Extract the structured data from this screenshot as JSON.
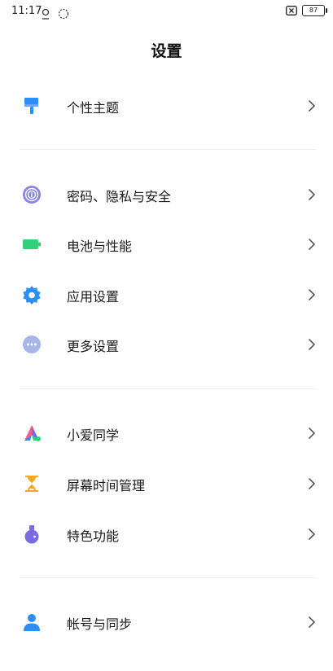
{
  "status_bar": {
    "time": "11:17",
    "battery": "87"
  },
  "header": {
    "title": "设置"
  },
  "groups": [
    {
      "items": [
        {
          "label": "个性主题",
          "icon": "paintbrush-icon"
        }
      ]
    },
    {
      "items": [
        {
          "label": "密码、隐私与安全",
          "icon": "fingerprint-icon"
        },
        {
          "label": "电池与性能",
          "icon": "battery-icon"
        },
        {
          "label": "应用设置",
          "icon": "gear-icon"
        },
        {
          "label": "更多设置",
          "icon": "more-dots-icon"
        }
      ]
    },
    {
      "items": [
        {
          "label": "小爱同学",
          "icon": "xiaoai-icon"
        },
        {
          "label": "屏幕时间管理",
          "icon": "hourglass-icon"
        },
        {
          "label": "特色功能",
          "icon": "flask-icon"
        }
      ]
    },
    {
      "items": [
        {
          "label": "帐号与同步",
          "icon": "person-icon"
        }
      ]
    }
  ],
  "colors": {
    "theme_icon": "#2c8ef8",
    "privacy_icon": "#8a83e6",
    "battery_icon": "#2fd27a",
    "gear_icon": "#2c8ef8",
    "more_icon": "#a7b6e8",
    "hourglass_icon": "#f5a623",
    "flask_icon": "#7b6be0",
    "person_icon": "#2c8ef8"
  }
}
